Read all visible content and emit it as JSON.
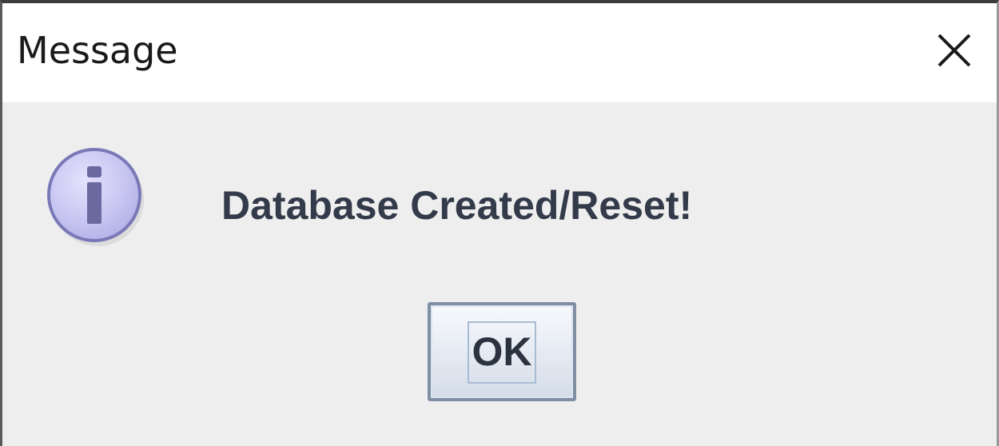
{
  "window": {
    "title": "Message",
    "close_icon": "close-icon"
  },
  "dialog": {
    "icon": "information-icon",
    "message": "Database Created/Reset!",
    "ok_label": "OK"
  },
  "colors": {
    "title_bar": "#ffffff",
    "content_background": "#eeeeee",
    "message_text": "#333a4a",
    "icon_fill": "#c9c7f2",
    "icon_glyph": "#6a6aa0"
  }
}
